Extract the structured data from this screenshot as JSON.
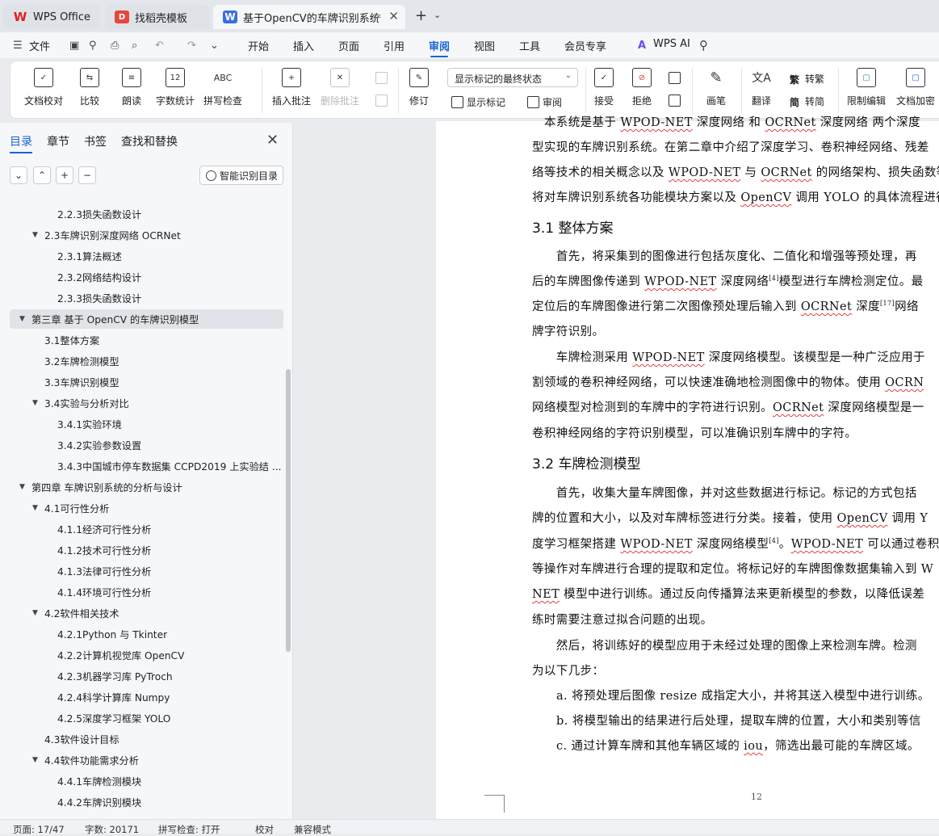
{
  "tabs": {
    "wps_office": "WPS Office",
    "templates": "找稻壳模板",
    "document": "基于OpenCV的车牌识别系统"
  },
  "menu": {
    "file": "文件",
    "items": [
      "开始",
      "插入",
      "页面",
      "引用",
      "审阅",
      "视图",
      "工具",
      "会员专享"
    ],
    "wps_ai": "WPS AI"
  },
  "ribbon": {
    "doc_check": "文档校对",
    "compare": "比较",
    "read_aloud": "朗读",
    "word_count": "字数统计",
    "spell_check": "拼写检查",
    "insert_comment": "插入批注",
    "delete_comment": "删除批注",
    "revise": "修订",
    "markup_state": "显示标记的最终状态",
    "show_markup": "显示标记",
    "review_pane": "审阅",
    "accept": "接受",
    "reject": "拒绝",
    "pen": "画笔",
    "translate": "翻译",
    "to_traditional": "转繁",
    "to_simplified": "转简",
    "restrict_edit": "限制编辑",
    "doc_encrypt": "文档加密",
    "word_count_icon_text": "12",
    "spell_icon_text": "ABC"
  },
  "sidebar": {
    "tabs": [
      "目录",
      "章节",
      "书签",
      "查找和替换"
    ],
    "smart_toc": "智能识别目录",
    "toc": [
      {
        "text": "2.2.3损失函数设计",
        "level": 3
      },
      {
        "text": "2.3车牌识别深度网络 OCRNet",
        "level": 2,
        "caret": "▼"
      },
      {
        "text": "2.3.1算法概述",
        "level": 3
      },
      {
        "text": "2.3.2网络结构设计",
        "level": 3
      },
      {
        "text": "2.3.3损失函数设计",
        "level": 3
      },
      {
        "text": "第三章 基于 OpenCV 的车牌识别模型",
        "level": 1,
        "caret": "▼",
        "selected": true
      },
      {
        "text": "3.1整体方案",
        "level": 2
      },
      {
        "text": "3.2车牌检测模型",
        "level": 2
      },
      {
        "text": "3.3车牌识别模型",
        "level": 2
      },
      {
        "text": "3.4实验与分析对比",
        "level": 2,
        "caret": "▼"
      },
      {
        "text": "3.4.1实验环境",
        "level": 3
      },
      {
        "text": "3.4.2实验参数设置",
        "level": 3
      },
      {
        "text": "3.4.3中国城市停车数据集 CCPD2019 上实验结 ...",
        "level": 3
      },
      {
        "text": "第四章 车牌识别系统的分析与设计",
        "level": 1,
        "caret": "▼"
      },
      {
        "text": "4.1可行性分析",
        "level": 2,
        "caret": "▼"
      },
      {
        "text": "4.1.1经济可行性分析",
        "level": 3
      },
      {
        "text": "4.1.2技术可行性分析",
        "level": 3
      },
      {
        "text": "4.1.3法律可行性分析",
        "level": 3
      },
      {
        "text": "4.1.4环境可行性分析",
        "level": 3
      },
      {
        "text": "4.2软件相关技术",
        "level": 2,
        "caret": "▼"
      },
      {
        "text": "4.2.1Python 与 Tkinter",
        "level": 3
      },
      {
        "text": "4.2.2计算机视觉库 OpenCV",
        "level": 3
      },
      {
        "text": "4.2.3机器学习库 PyTroch",
        "level": 3
      },
      {
        "text": "4.2.4科学计算库 Numpy",
        "level": 3
      },
      {
        "text": "4.2.5深度学习框架 YOLO",
        "level": 3
      },
      {
        "text": "4.3软件设计目标",
        "level": 2
      },
      {
        "text": "4.4软件功能需求分析",
        "level": 2,
        "caret": "▼"
      },
      {
        "text": "4.4.1车牌检测模块",
        "level": 3
      },
      {
        "text": "4.4.2车牌识别模块",
        "level": 3
      }
    ]
  },
  "document": {
    "page_number": "12"
  },
  "status": {
    "page": "页面: 17/47",
    "words": "字数: 20171",
    "spell": "拼写检查: 打开",
    "proof": "校对",
    "compat": "兼容模式"
  }
}
